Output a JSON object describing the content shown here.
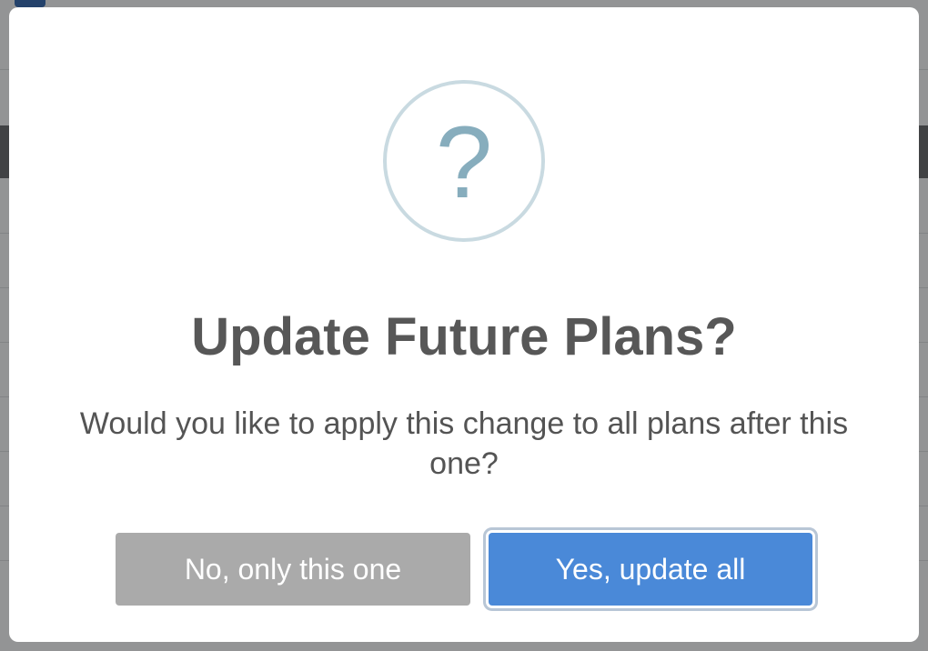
{
  "dialog": {
    "icon": "question-mark-icon",
    "icon_glyph": "?",
    "title": "Update Future Plans?",
    "message": "Would you like to apply this change to all plans after this one?",
    "cancel_label": "No, only this one",
    "confirm_label": "Yes, update all"
  },
  "colors": {
    "confirm_button": "#4a89d8",
    "cancel_button": "#aaaaaa",
    "icon_ring": "#c9dae1",
    "icon_glyph": "#87adbd",
    "title_text": "#575757"
  }
}
